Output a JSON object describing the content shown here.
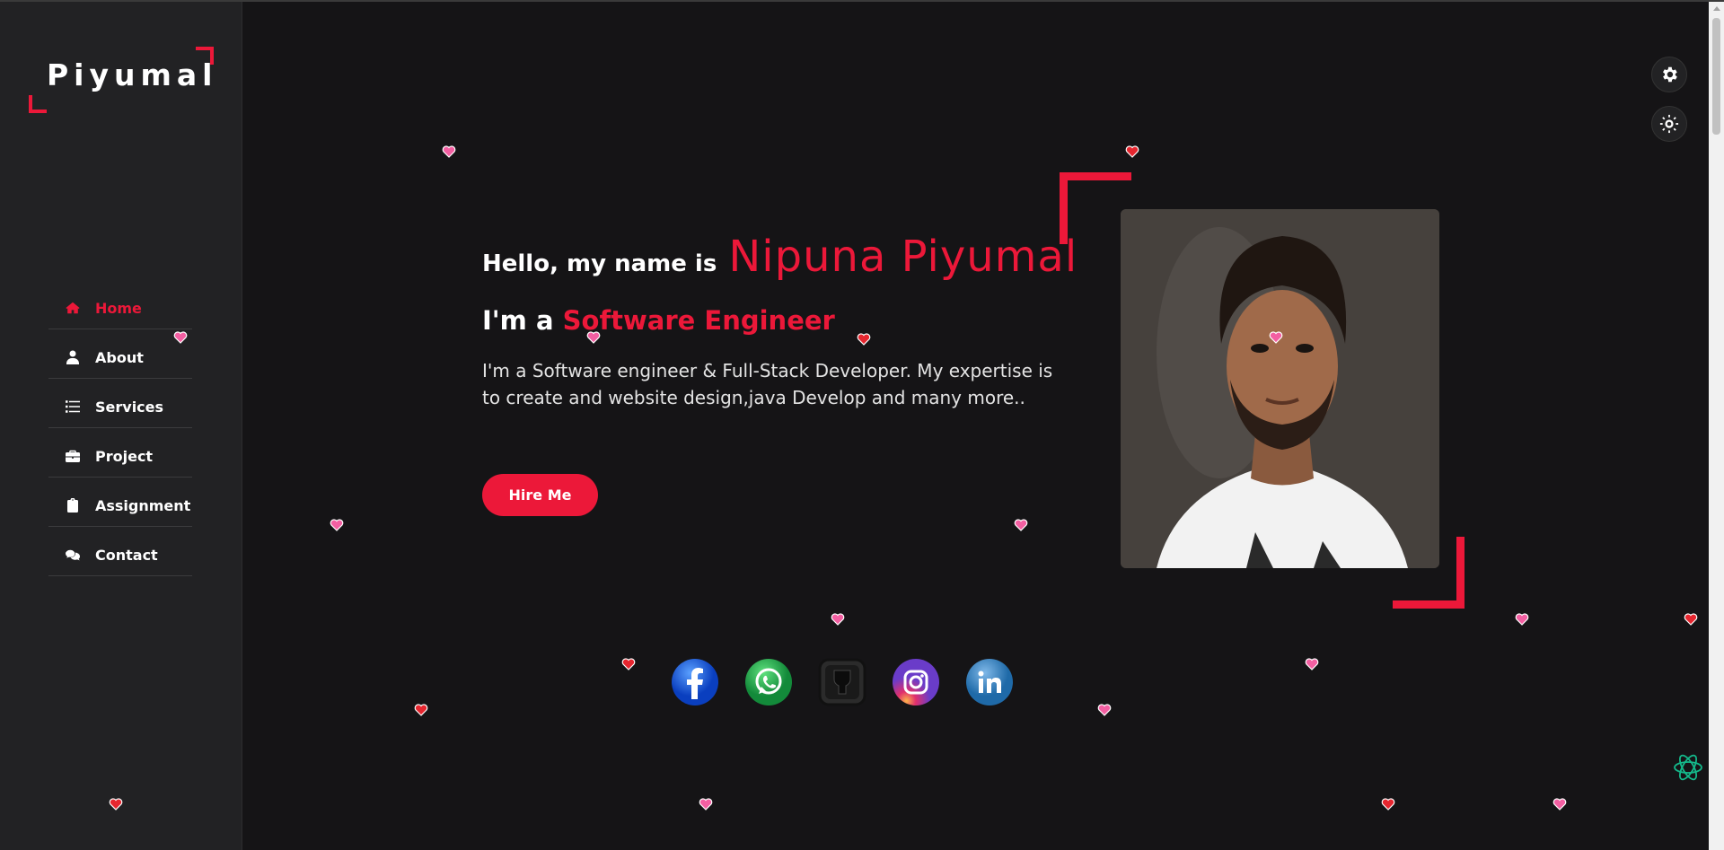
{
  "brand": {
    "logo_text": "Piyumal",
    "accent_color": "#ec1839"
  },
  "nav": {
    "items": [
      {
        "label": "Home",
        "icon": "home-icon",
        "active": true
      },
      {
        "label": "About",
        "icon": "user-icon",
        "active": false
      },
      {
        "label": "Services",
        "icon": "list-icon",
        "active": false
      },
      {
        "label": "Project",
        "icon": "briefcase-icon",
        "active": false
      },
      {
        "label": "Assignment",
        "icon": "clipboard-icon",
        "active": false
      },
      {
        "label": "Contact",
        "icon": "comments-icon",
        "active": false
      }
    ]
  },
  "hero": {
    "greeting": "Hello, my name is",
    "name": "Nipuna  Piyumal",
    "role_prefix": "I'm a",
    "role": "Software Engineer",
    "description": "I'm a Software engineer & Full-Stack Developer. My expertise is to create and website design,java Develop and many more..",
    "cta_label": "Hire Me"
  },
  "social": [
    {
      "name": "facebook-icon"
    },
    {
      "name": "whatsapp-icon"
    },
    {
      "name": "github-icon"
    },
    {
      "name": "instagram-icon"
    },
    {
      "name": "linkedin-icon"
    }
  ],
  "controls": {
    "settings": "gear-icon",
    "theme": "sun-icon"
  }
}
